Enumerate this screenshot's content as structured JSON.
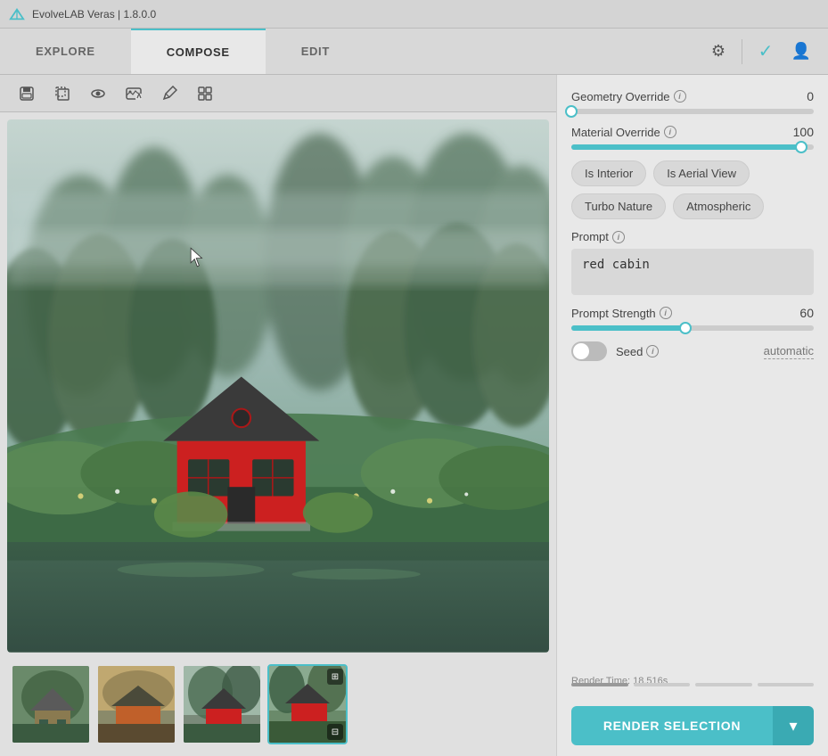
{
  "app": {
    "title": "EvolveLAB Veras | 1.8.0.0"
  },
  "nav": {
    "tabs": [
      {
        "id": "explore",
        "label": "EXPLORE",
        "active": false
      },
      {
        "id": "compose",
        "label": "COMPOSE",
        "active": false
      },
      {
        "id": "edit",
        "label": "EDIT",
        "active": true
      }
    ]
  },
  "toolbar": {
    "buttons": [
      {
        "id": "save",
        "icon": "💾",
        "label": "save"
      },
      {
        "id": "crop",
        "icon": "⊡",
        "label": "crop"
      },
      {
        "id": "eye",
        "icon": "👁",
        "label": "view"
      },
      {
        "id": "image-edit",
        "icon": "🖼",
        "label": "image-edit"
      },
      {
        "id": "pen",
        "icon": "✏",
        "label": "pen"
      },
      {
        "id": "grid",
        "icon": "⊞",
        "label": "grid"
      }
    ]
  },
  "thumbnails": [
    {
      "id": 1,
      "bg": "#6a8a6a",
      "selected": false
    },
    {
      "id": 2,
      "bg": "#8a7a50",
      "selected": false
    },
    {
      "id": 3,
      "bg": "#7a6060",
      "selected": false
    },
    {
      "id": 4,
      "bg": "#5a7a60",
      "selected": true,
      "has_overlay": true,
      "has_bottom": true
    }
  ],
  "right_panel": {
    "geometry_override": {
      "label": "Geometry Override",
      "value": 0,
      "fill_pct": 0
    },
    "material_override": {
      "label": "Material Override",
      "value": 100,
      "fill_pct": 95
    },
    "chips": [
      {
        "id": "is-interior",
        "label": "Is Interior"
      },
      {
        "id": "is-aerial-view",
        "label": "Is Aerial View"
      },
      {
        "id": "turbo-nature",
        "label": "Turbo Nature"
      },
      {
        "id": "atmospheric",
        "label": "Atmospheric"
      }
    ],
    "prompt": {
      "label": "Prompt",
      "value": "red cabin"
    },
    "prompt_strength": {
      "label": "Prompt Strength",
      "value": 60,
      "fill_pct": 47
    },
    "seed": {
      "label": "Seed",
      "enabled": false,
      "value": "automatic"
    },
    "render_time": {
      "label": "Render Time: 18.516s"
    },
    "render_button": {
      "label": "RENDER SELECTION"
    }
  },
  "icons": {
    "settings": "⚙",
    "check": "✓",
    "user": "👤",
    "info": "i",
    "chevron_down": "▾"
  }
}
